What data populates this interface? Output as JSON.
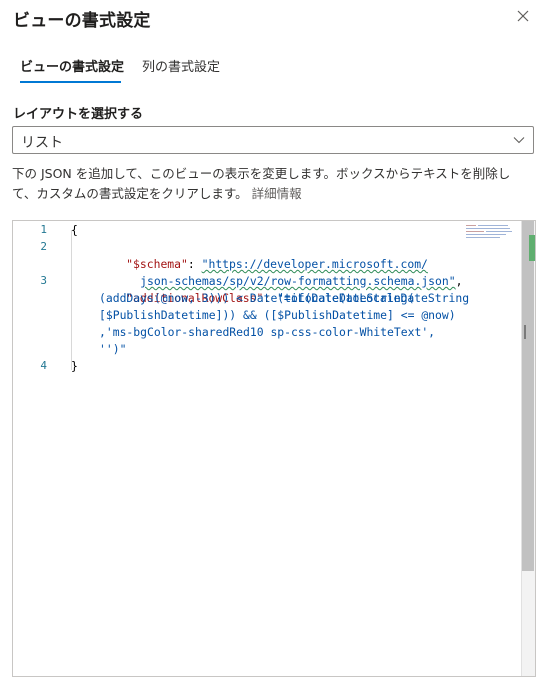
{
  "panel": {
    "title": "ビューの書式設定",
    "close_icon": "close-icon"
  },
  "tabs": [
    {
      "label": "ビューの書式設定",
      "active": true
    },
    {
      "label": "列の書式設定",
      "active": false
    }
  ],
  "layout": {
    "label": "レイアウトを選択する",
    "selected": "リスト",
    "chevron_icon": "chevron-down-icon"
  },
  "description": {
    "text": "下の JSON を追加して、このビューの表示を変更します。ボックスからテキストを削除して、カスタムの書式設定をクリアします。",
    "link": "詳細情報"
  },
  "editor": {
    "line_numbers": [
      "1",
      "2",
      "3",
      "4"
    ],
    "lines": {
      "l1": "{",
      "l2_key": "\"$schema\"",
      "l2_colon": ": ",
      "l2_url_a": "\"https://developer.microsoft.com/",
      "l2_url_b": "json-schemas/sp/v2/row-formatting.schema.json\"",
      "l2_comma": ",",
      "l3_key": "\"additionalRowClass\"",
      "l3_colon": ": ",
      "l3_v1": "\"=if(Date(toLocaleDateString",
      "l3_v2": "(addDays(@now,-3))) < Date(toLocaleDateString(",
      "l3_v3": "[$PublishDatetime])) && ([$PublishDatetime] <= @now)",
      "l3_v4": ",'ms-bgColor-sharedRed10 sp-css-color-WhiteText',",
      "l3_v5": "'')\"",
      "l4": "}"
    }
  },
  "colors": {
    "accent": "#0078d4",
    "json_key": "#a31515",
    "json_string": "#0451a5",
    "line_number": "#237893"
  }
}
